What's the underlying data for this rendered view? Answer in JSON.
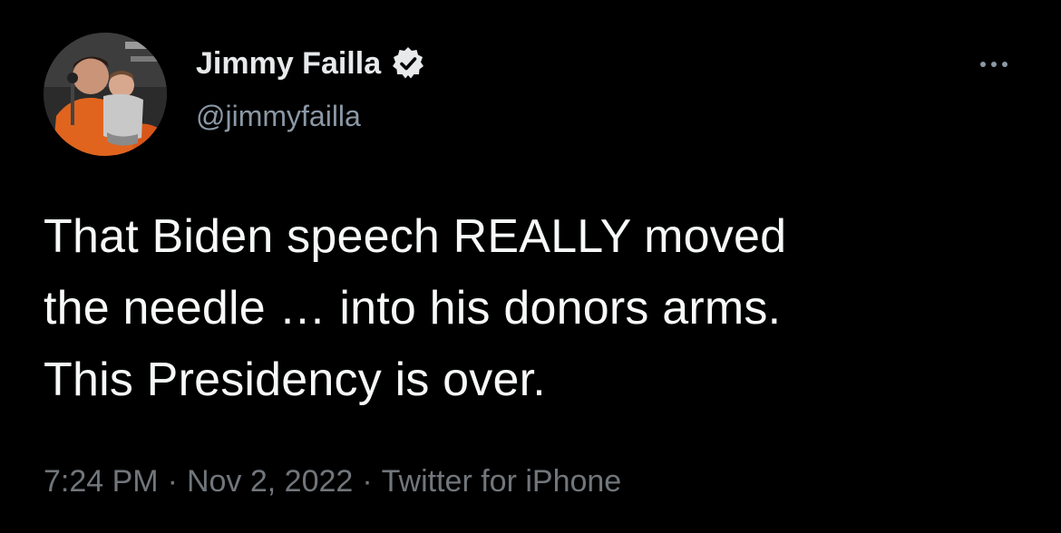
{
  "tweet": {
    "author": {
      "display_name": "Jimmy Failla",
      "handle": "@jimmyfailla",
      "verified": true,
      "avatar_icon": "profile-photo"
    },
    "more_icon": "more-options-icon",
    "text_lines": [
      "That Biden speech REALLY moved",
      "the needle … into his donors arms.",
      "This Presidency is over."
    ],
    "meta": {
      "time": "7:24 PM",
      "separator": "·",
      "date": "Nov 2, 2022",
      "source": "Twitter for iPhone"
    }
  },
  "colors": {
    "background": "#000000",
    "primary_text": "#f7f9f9",
    "secondary_text": "#71767b",
    "handle_text": "#8b98a5"
  }
}
